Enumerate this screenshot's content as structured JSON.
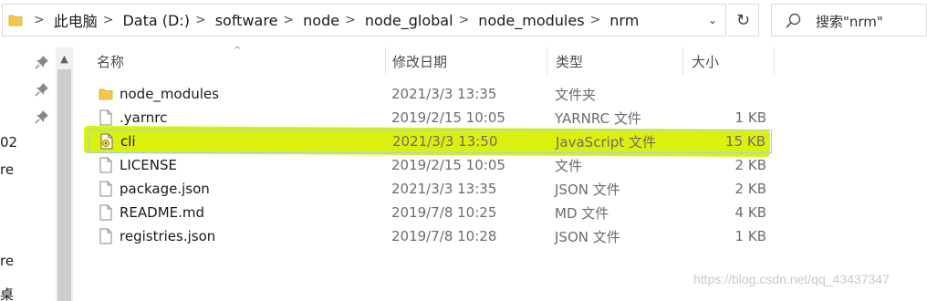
{
  "address": {
    "crumbs": [
      "此电脑",
      "Data (D:)",
      "software",
      "node",
      "node_global",
      "node_modules",
      "nrm"
    ],
    "separator": ">",
    "dropdown_glyph": "⌄",
    "refresh_glyph": "↻",
    "search_placeholder": "搜索\"nrm\""
  },
  "nav": {
    "fragments": [
      "02",
      "re",
      "re",
      "桌"
    ],
    "scroll_up_glyph": "▲"
  },
  "columns": {
    "name": "名称",
    "date": "修改日期",
    "type": "类型",
    "size": "大小",
    "sort_caret": "^"
  },
  "files": [
    {
      "name": "node_modules",
      "date": "2021/3/3 13:35",
      "type": "文件夹",
      "size": "",
      "icon": "folder-icon"
    },
    {
      "name": ".yarnrc",
      "date": "2019/2/15 10:05",
      "type": "YARNRC 文件",
      "size": "1 KB",
      "icon": "file-icon"
    },
    {
      "name": "cli",
      "date": "2021/3/3 13:50",
      "type": "JavaScript 文件",
      "size": "15 KB",
      "icon": "js-file-icon"
    },
    {
      "name": "LICENSE",
      "date": "2019/2/15 10:05",
      "type": "文件",
      "size": "2 KB",
      "icon": "file-icon"
    },
    {
      "name": "package.json",
      "date": "2021/3/3 13:35",
      "type": "JSON 文件",
      "size": "2 KB",
      "icon": "file-icon"
    },
    {
      "name": "README.md",
      "date": "2019/7/8 10:25",
      "type": "MD 文件",
      "size": "4 KB",
      "icon": "file-icon"
    },
    {
      "name": "registries.json",
      "date": "2019/7/8 10:28",
      "type": "JSON 文件",
      "size": "1 KB",
      "icon": "file-icon"
    }
  ],
  "selected_file": "cli",
  "highlight_color": "#d9f000",
  "selection_color": "#cce8ff",
  "watermark": "https://blog.csdn.net/qq_43437347"
}
